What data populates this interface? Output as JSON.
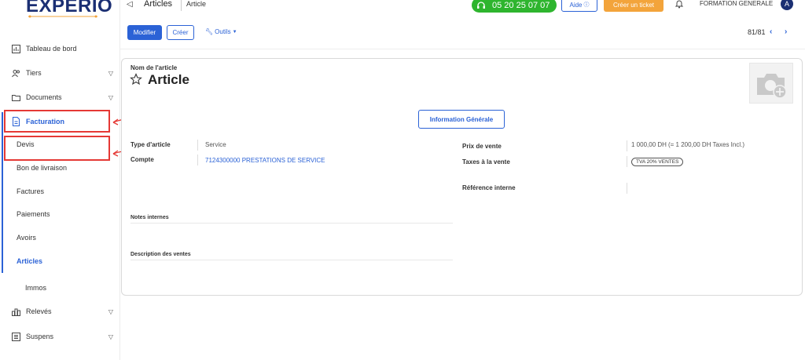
{
  "brand": {
    "logo": "EXPERIO"
  },
  "sidebar": {
    "items": [
      {
        "label": "Tableau de bord",
        "icon": "dashboard-icon"
      },
      {
        "label": "Tiers",
        "icon": "users-icon"
      },
      {
        "label": "Documents",
        "icon": "folder-icon"
      },
      {
        "label": "Facturation",
        "icon": "invoice-icon"
      },
      {
        "label": "Devis"
      },
      {
        "label": "Bon de livraison"
      },
      {
        "label": "Factures"
      },
      {
        "label": "Paiements"
      },
      {
        "label": "Avoirs"
      },
      {
        "label": "Articles"
      },
      {
        "label": "Immos"
      },
      {
        "label": "Relevés",
        "icon": "chart-icon"
      },
      {
        "label": "Suspens",
        "icon": "list-icon"
      }
    ]
  },
  "topbar": {
    "title": "Articles",
    "subtitle": "Article",
    "phone": "05 20 25 07 07",
    "help_label": "Aide",
    "ticket_label": "Créer un ticket",
    "company": "FORMATION GENERALE",
    "avatar_letter": "A"
  },
  "actions": {
    "modify_label": "Modifier",
    "create_label": "Créer",
    "tools_label": "Outils",
    "pager": "81/81"
  },
  "article": {
    "name_label": "Nom de l'article",
    "name": "Article",
    "tab_label": "Information Générale",
    "type_label": "Type d'article",
    "type_value": "Service",
    "account_label": "Compte",
    "account_value": "7124300000 PRESTATIONS DE SERVICE",
    "price_label": "Prix de vente",
    "price_value": "1 000,00 DH",
    "price_ttc": "(= 1 200,00 DH Taxes Incl.)",
    "tax_label": "Taxes à la vente",
    "tax_value": "TVA 20% VENTES",
    "ref_label": "Référence interne",
    "notes_label": "Notes internes",
    "sales_desc_label": "Description des ventes"
  },
  "colors": {
    "accent": "#2b62d6",
    "phone": "#2eb52e",
    "ticket": "#f3a43b",
    "annotation": "#e53935",
    "logo": "#1b2f73"
  }
}
